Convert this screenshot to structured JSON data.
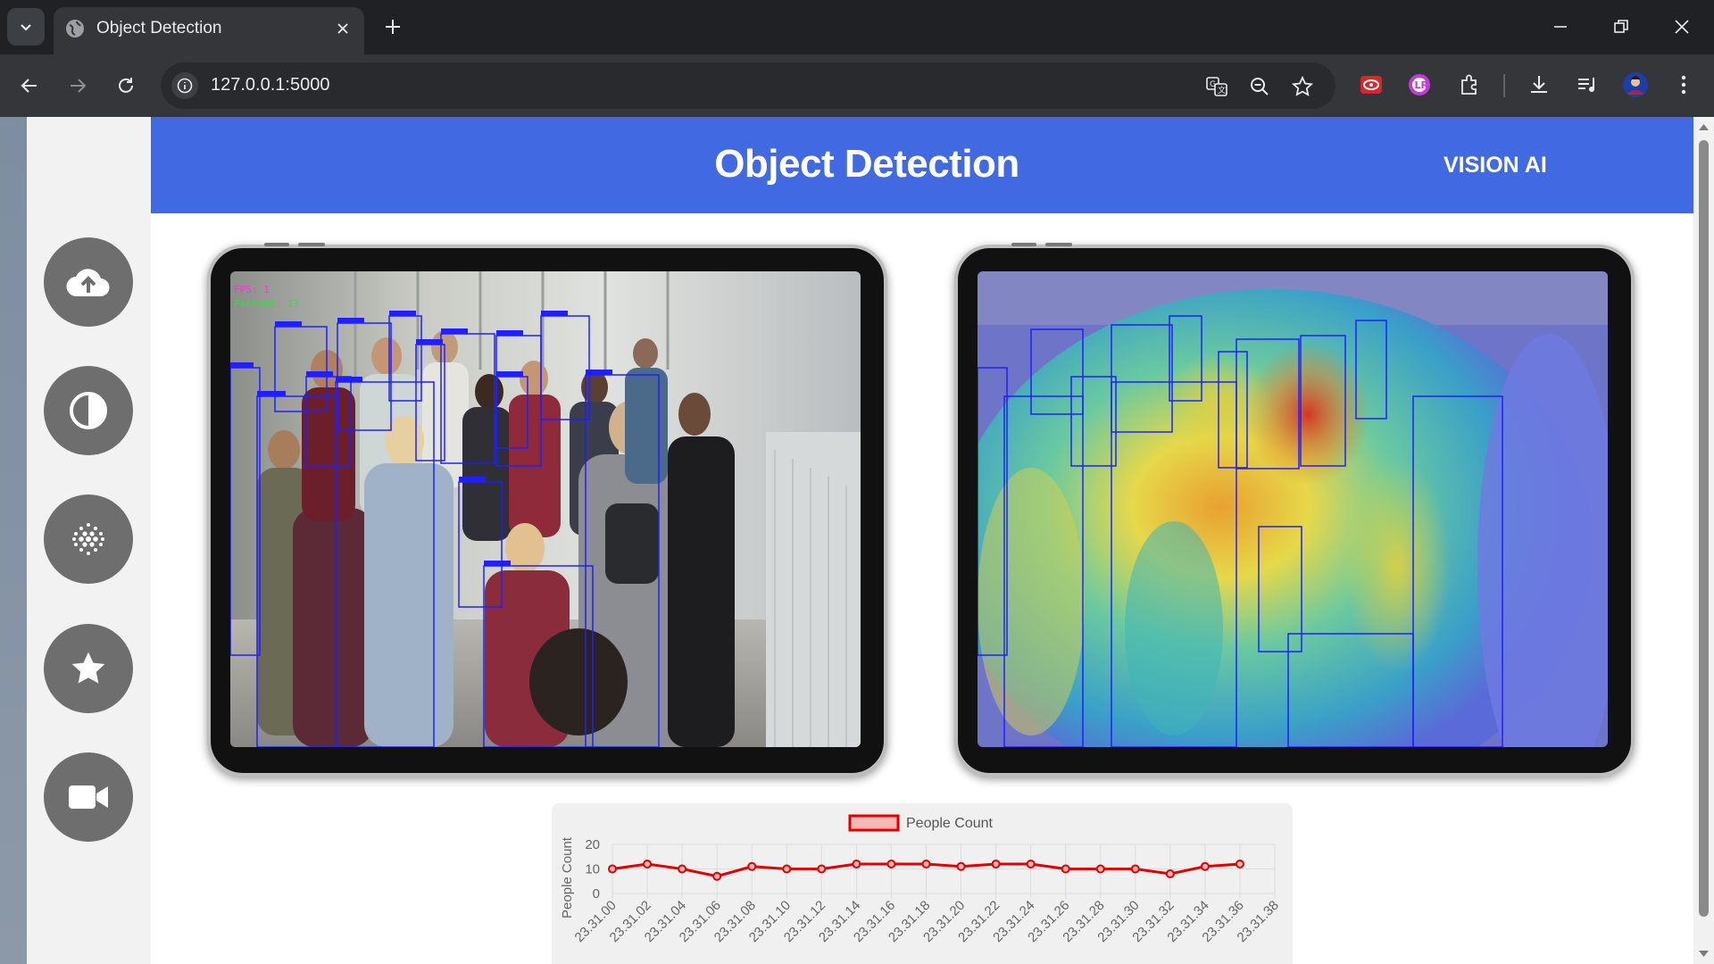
{
  "browser": {
    "tab_title": "Object Detection",
    "url": "127.0.0.1:5000"
  },
  "page": {
    "title": "Object Detection",
    "brand": "VISION AI"
  },
  "sidebar": {
    "items": [
      {
        "name": "upload",
        "icon": "cloud-upload-icon"
      },
      {
        "name": "contrast",
        "icon": "contrast-icon"
      },
      {
        "name": "heatmap",
        "icon": "dots-grid-icon"
      },
      {
        "name": "favorites",
        "icon": "star-icon"
      },
      {
        "name": "camera",
        "icon": "video-camera-icon"
      }
    ]
  },
  "video": {
    "fps_label": "FPS: 1",
    "persons_label": "Persons: 13"
  },
  "colors": {
    "header": "#4169e1",
    "line": "#e00000",
    "box": "#1f1fff"
  },
  "chart_data": {
    "type": "line",
    "title": "",
    "legend": "People Count",
    "ylabel": "People Count",
    "xlabel": "",
    "ylim": [
      0,
      20
    ],
    "yticks": [
      0,
      10,
      20
    ],
    "categories": [
      "23.31.00",
      "23.31.02",
      "23.31.04",
      "23.31.06",
      "23.31.08",
      "23.31.10",
      "23.31.12",
      "23.31.14",
      "23.31.16",
      "23.31.18",
      "23.31.20",
      "23.31.22",
      "23.31.24",
      "23.31.26",
      "23.31.28",
      "23.31.30",
      "23.31.32",
      "23.31.34",
      "23.31.36",
      "23.31.38"
    ],
    "series": [
      {
        "name": "People Count",
        "values": [
          10,
          12,
          10,
          7,
          11,
          10,
          10,
          12,
          12,
          12,
          11,
          12,
          12,
          10,
          10,
          10,
          8,
          11,
          12
        ]
      }
    ]
  }
}
